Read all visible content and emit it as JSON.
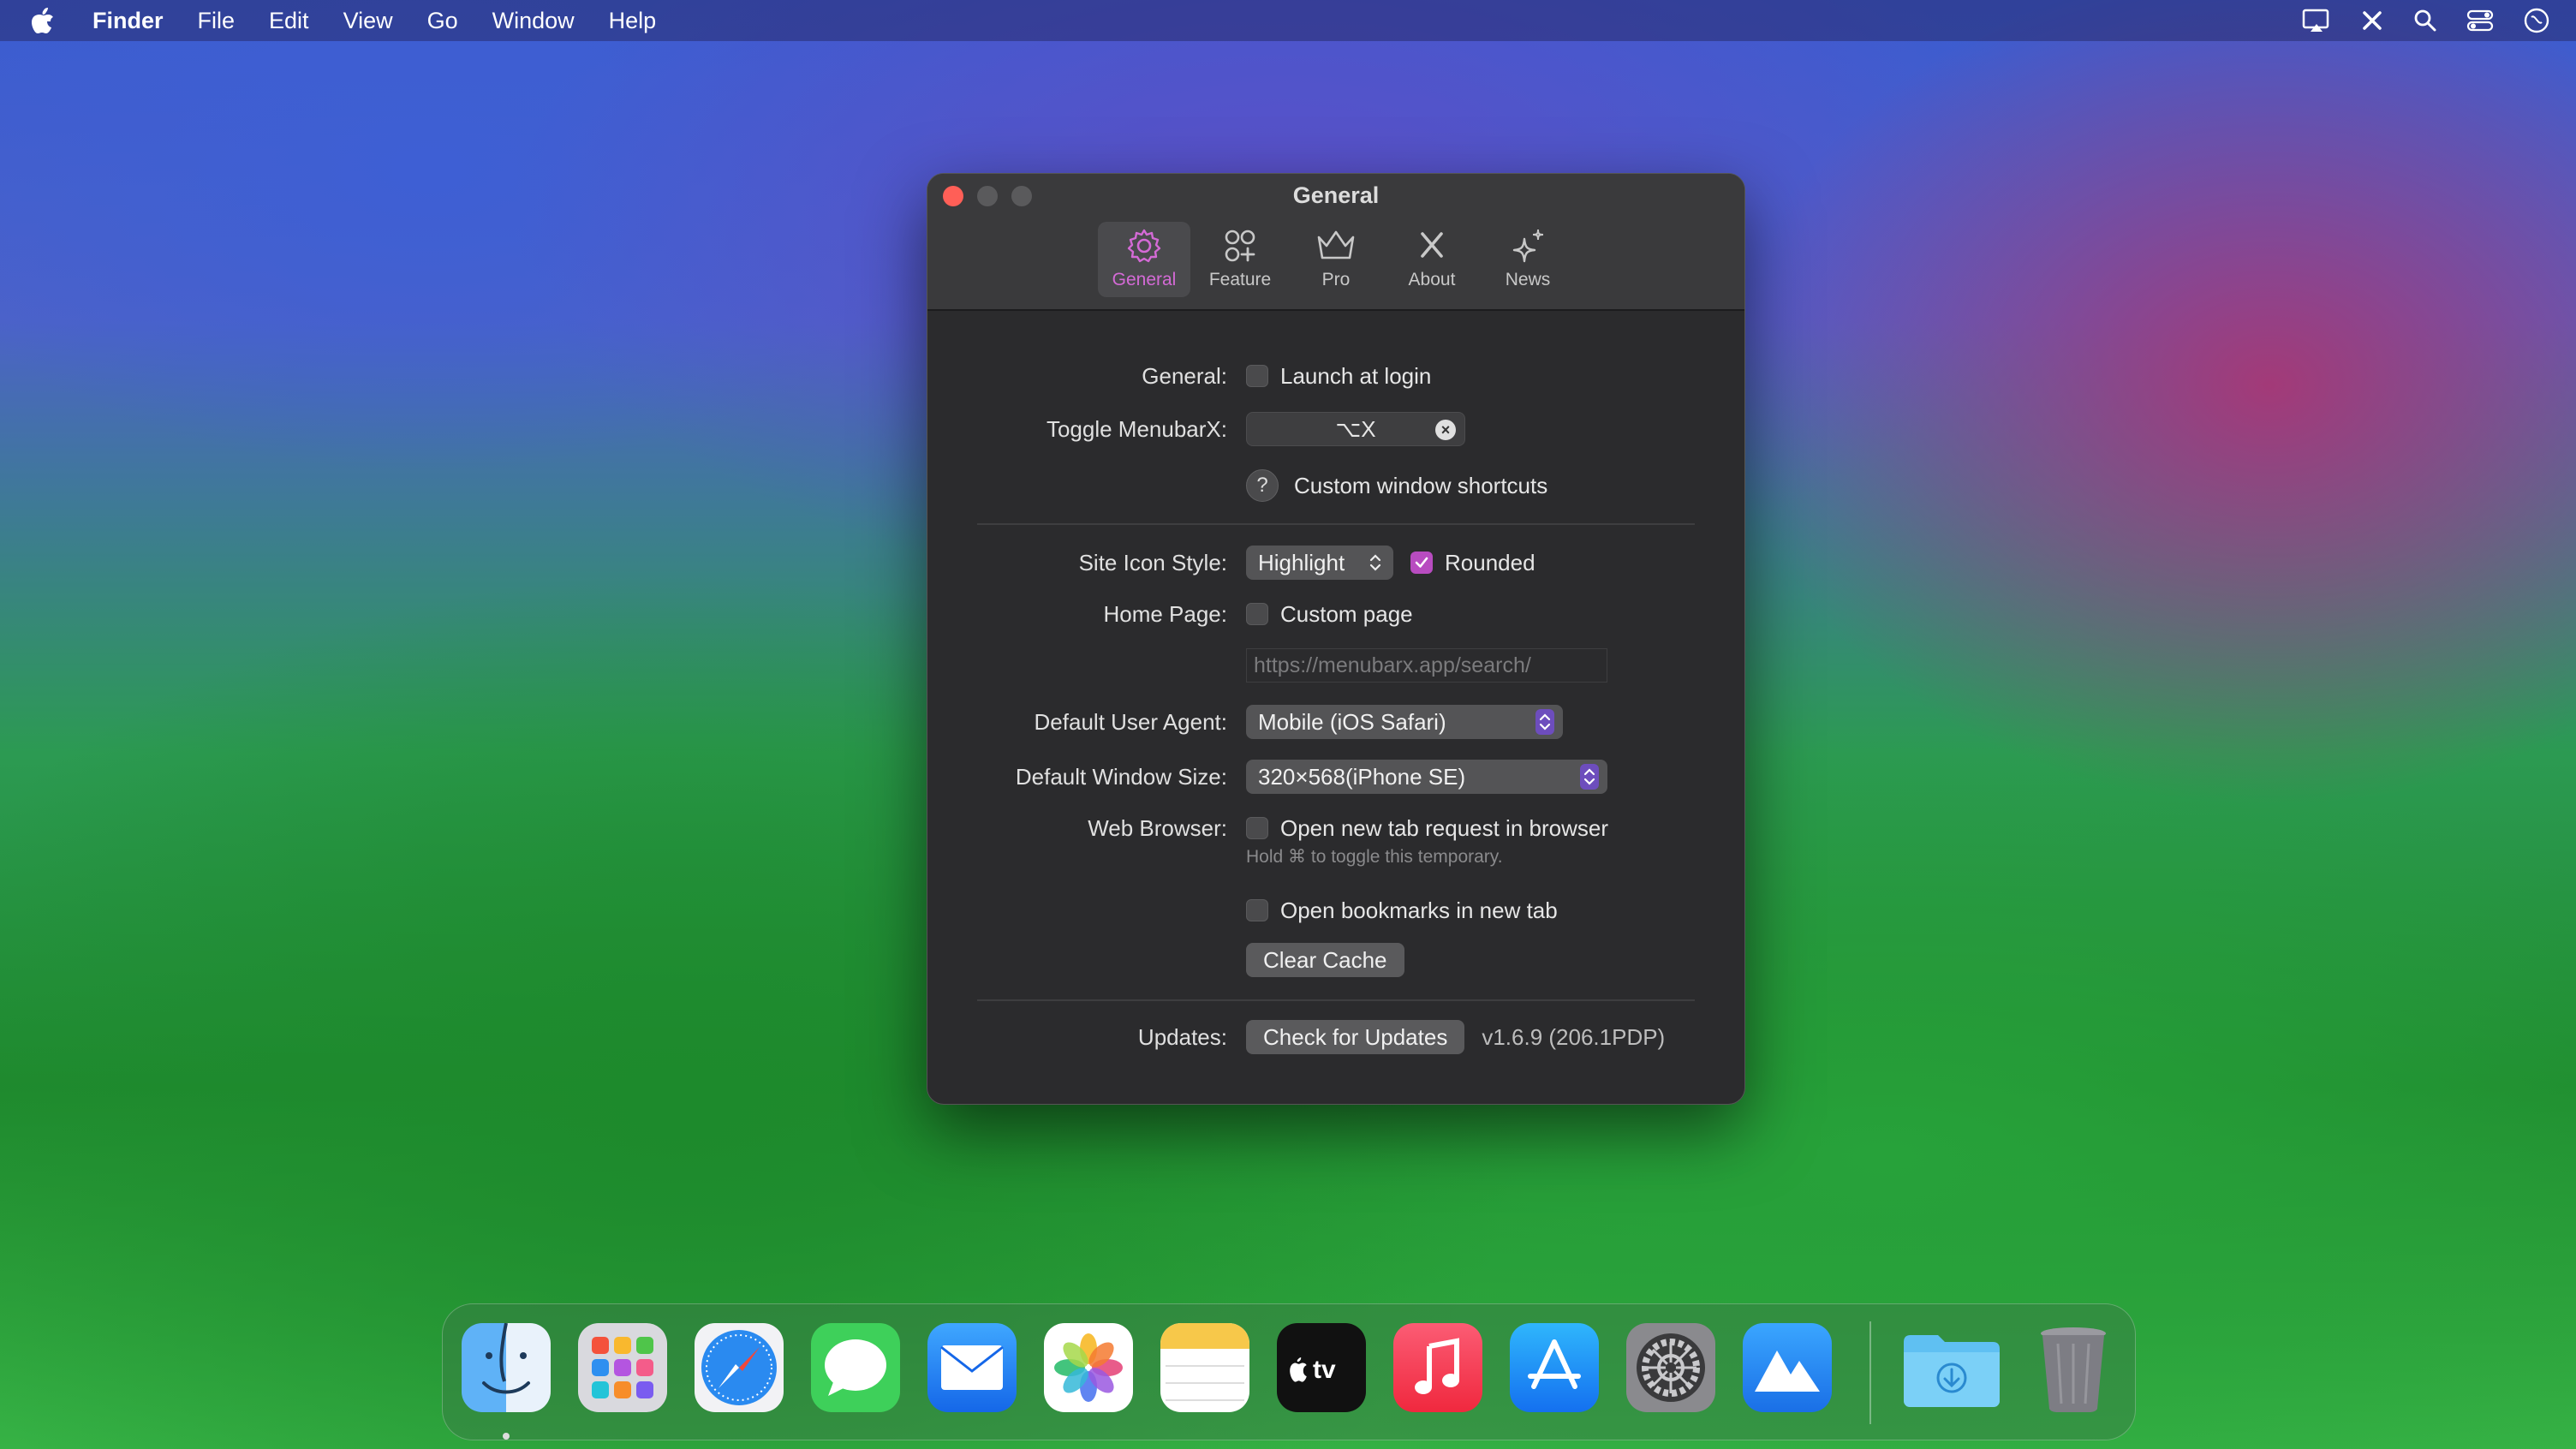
{
  "menubar": {
    "app_name": "Finder",
    "items": [
      "File",
      "Edit",
      "View",
      "Go",
      "Window",
      "Help"
    ]
  },
  "window": {
    "title": "General",
    "tabs": [
      {
        "label": "General",
        "icon": "gear-icon",
        "active": true
      },
      {
        "label": "Feature",
        "icon": "feature-grid-icon",
        "active": false
      },
      {
        "label": "Pro",
        "icon": "crown-icon",
        "active": false
      },
      {
        "label": "About",
        "icon": "menubarx-icon",
        "active": false
      },
      {
        "label": "News",
        "icon": "sparkles-icon",
        "active": false
      }
    ],
    "accent_color": "#d46ad6"
  },
  "settings": {
    "general_label": "General:",
    "launch_at_login": {
      "label": "Launch at login",
      "checked": false
    },
    "toggle_label": "Toggle MenubarX:",
    "toggle_shortcut": "⌥X",
    "custom_shortcuts_label": "Custom window shortcuts",
    "site_icon_style_label": "Site Icon Style:",
    "site_icon_style_value": "Highlight",
    "rounded": {
      "label": "Rounded",
      "checked": true
    },
    "home_page_label": "Home Page:",
    "custom_page": {
      "label": "Custom page",
      "checked": false
    },
    "home_url_placeholder": "https://menubarx.app/search/",
    "user_agent_label": "Default User Agent:",
    "user_agent_value": "Mobile (iOS Safari)",
    "window_size_label": "Default Window Size:",
    "window_size_value": "320×568(iPhone SE)",
    "web_browser_label": "Web Browser:",
    "open_new_tab": {
      "label": "Open new tab request in browser",
      "checked": false
    },
    "toggle_hint": "Hold ⌘ to toggle this temporary.",
    "open_bookmarks": {
      "label": "Open bookmarks in new tab",
      "checked": false
    },
    "clear_cache_label": "Clear Cache",
    "updates_label": "Updates:",
    "check_updates_label": "Check for Updates",
    "version": "v1.6.9 (206.1PDP)"
  },
  "dock": {
    "apps": [
      "Finder",
      "Launchpad",
      "Safari",
      "Messages",
      "Mail",
      "Photos",
      "Notes",
      "TV",
      "Music",
      "App Store",
      "System Settings",
      "MenubarX",
      "Downloads",
      "Trash"
    ]
  }
}
